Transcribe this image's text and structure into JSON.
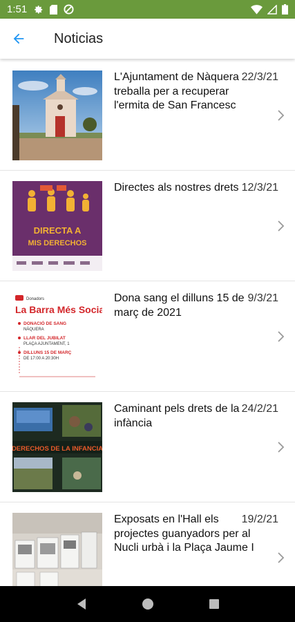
{
  "status_bar": {
    "time": "1:51",
    "background": "#6a9a3c",
    "left_icons": [
      "gear-icon",
      "sim-card-icon",
      "data-saver-icon"
    ],
    "right_icons": [
      "wifi-icon",
      "cell-signal-icon",
      "battery-icon"
    ]
  },
  "header": {
    "back_icon": "arrow-back-icon",
    "title": "Noticias",
    "accent": "#2196f3"
  },
  "news": [
    {
      "title": "L'Ajuntament de Nàquera treballa per a recuperar l'ermita de San Francesc",
      "date": "22/3/21",
      "thumb": "hermitage-photo"
    },
    {
      "title": "Directes als nostres drets",
      "date": "12/3/21",
      "thumb": "directa-a-mis-derechos-poster",
      "thumb_text": "DIRECTA A MIS DERECHOS"
    },
    {
      "title": "Dona sang el dilluns 15 de març de 2021",
      "date": "9/3/21",
      "thumb": "blood-donation-poster",
      "thumb_text": {
        "brand": "La Barra Més Social",
        "lines": [
          "DONACIÓ DE SANG",
          "NÀQUERA",
          "LLAR DEL JUBILAT",
          "PLAÇA AJUNTAMENT, 1",
          "DILLUNS 15 DE MARÇ",
          "DE 17:00 A 20:30H"
        ]
      }
    },
    {
      "title": "Caminant pels drets de la infància",
      "date": "24/2/21",
      "thumb": "video-collage",
      "thumb_text": "DERECHOS DE LA INFANCIA"
    },
    {
      "title": "Exposats en l'Hall els projectes guanyadors per al Nucli urbà i la Plaça Jaume I",
      "date": "19/2/21",
      "thumb": "exhibition-photo"
    }
  ],
  "nav_bar": {
    "buttons": [
      "back-triangle-icon",
      "home-circle-icon",
      "recents-square-icon"
    ]
  }
}
